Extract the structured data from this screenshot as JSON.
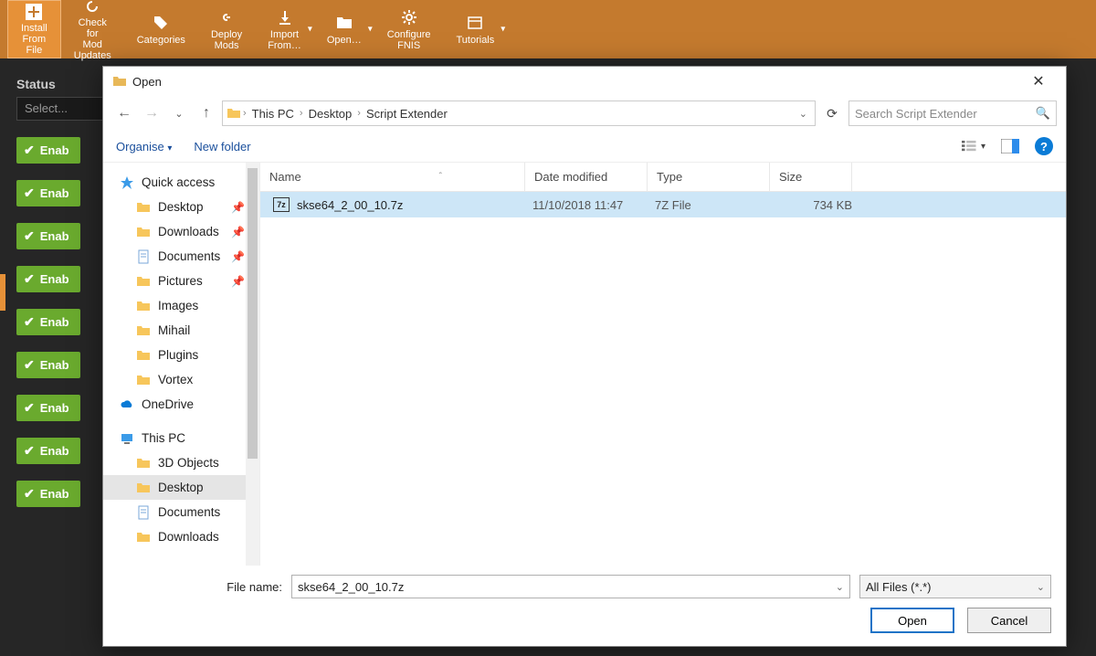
{
  "host": {
    "toolbar": [
      {
        "label": "Install From File",
        "icon": "plus",
        "selected": true
      },
      {
        "label": "Check for Mod Updates",
        "icon": "refresh"
      },
      {
        "label": "Categories",
        "icon": "tags"
      },
      {
        "label": "Deploy Mods",
        "icon": "link"
      },
      {
        "label": "Import From…",
        "icon": "download",
        "caret": true
      },
      {
        "label": "Open…",
        "icon": "folder",
        "caret": true
      },
      {
        "label": "Configure FNIS",
        "icon": "gear"
      },
      {
        "label": "Tutorials",
        "icon": "window",
        "caret": true
      }
    ],
    "status_label": "Status",
    "select_placeholder": "Select...",
    "enable_label": "Enab"
  },
  "dialog": {
    "title": "Open",
    "breadcrumb": [
      "This PC",
      "Desktop",
      "Script Extender"
    ],
    "search_placeholder": "Search Script Extender",
    "organise_label": "Organise",
    "newfolder_label": "New folder",
    "columns": {
      "name": "Name",
      "date": "Date modified",
      "type": "Type",
      "size": "Size"
    },
    "tree": [
      {
        "label": "Quick access",
        "icon": "star",
        "level": 0
      },
      {
        "label": "Desktop",
        "icon": "folder",
        "level": 1,
        "pin": true
      },
      {
        "label": "Downloads",
        "icon": "folder",
        "level": 1,
        "pin": true
      },
      {
        "label": "Documents",
        "icon": "doc",
        "level": 1,
        "pin": true
      },
      {
        "label": "Pictures",
        "icon": "folder",
        "level": 1,
        "pin": true
      },
      {
        "label": "Images",
        "icon": "folder",
        "level": 1
      },
      {
        "label": "Mihail",
        "icon": "folder",
        "level": 1
      },
      {
        "label": "Plugins",
        "icon": "folder",
        "level": 1
      },
      {
        "label": "Vortex",
        "icon": "folder",
        "level": 1
      },
      {
        "label": "OneDrive",
        "icon": "cloud",
        "level": 0
      },
      {
        "label": "This PC",
        "icon": "pc",
        "level": 0
      },
      {
        "label": "3D Objects",
        "icon": "folder",
        "level": 1
      },
      {
        "label": "Desktop",
        "icon": "folder",
        "level": 1,
        "selected": true
      },
      {
        "label": "Documents",
        "icon": "doc",
        "level": 1
      },
      {
        "label": "Downloads",
        "icon": "folder",
        "level": 1
      }
    ],
    "files": [
      {
        "name": "skse64_2_00_10.7z",
        "date": "11/10/2018 11:47",
        "type": "7Z File",
        "size": "734 KB",
        "selected": true
      }
    ],
    "filename_label": "File name:",
    "filename_value": "skse64_2_00_10.7z",
    "filter_value": "All Files (*.*)",
    "open_label": "Open",
    "cancel_label": "Cancel"
  }
}
